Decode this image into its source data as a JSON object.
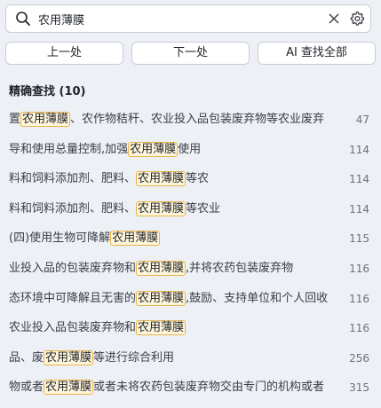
{
  "search": {
    "query": "农用薄膜",
    "placeholder": ""
  },
  "buttons": {
    "prev": "上一处",
    "next": "下一处",
    "ai_find_all": "AI 查找全部"
  },
  "results": {
    "title": "精确查找 (10)",
    "items": [
      {
        "before": "置",
        "match": "农用薄膜",
        "after": "、农作物秸秆、农业投入品包装废弃物等农业废弃",
        "page": "47"
      },
      {
        "before": "导和使用总量控制,加强",
        "match": "农用薄膜",
        "after": "使用",
        "page": "114"
      },
      {
        "before": "料和饲料添加剂、肥料、",
        "match": "农用薄膜",
        "after": "等农",
        "page": "114"
      },
      {
        "before": "料和饲料添加剂、肥料、",
        "match": "农用薄膜",
        "after": "等农业",
        "page": "114"
      },
      {
        "before": "(四)使用生物可降解",
        "match": "农用薄膜",
        "after": "",
        "page": "115"
      },
      {
        "before": "业投入品的包装废弃物和",
        "match": "农用薄膜",
        "after": ",并将农药包装废弃物",
        "page": "116"
      },
      {
        "before": "态环境中可降解且无害的",
        "match": "农用薄膜",
        "after": ",鼓励、支持单位和个人回收",
        "page": "116"
      },
      {
        "before": "农业投入品包装废弃物和",
        "match": "农用薄膜",
        "after": "",
        "page": "116"
      },
      {
        "before": "品、废",
        "match": "农用薄膜",
        "after": "等进行综合利用",
        "page": "256"
      },
      {
        "before": "物或者",
        "match": "农用薄膜",
        "after": "或者未将农药包装废弃物交由专门的机构或者",
        "page": "315"
      }
    ]
  }
}
